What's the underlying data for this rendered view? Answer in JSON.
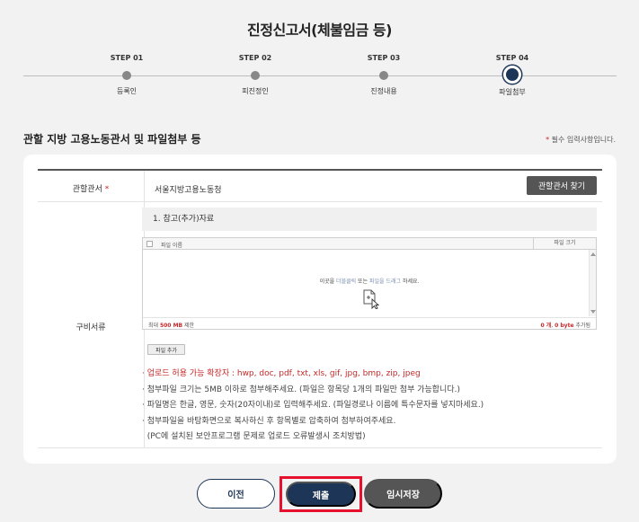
{
  "title": "진정신고서(체불임금 등)",
  "steps": [
    {
      "label": "STEP 01",
      "name": "등록인"
    },
    {
      "label": "STEP 02",
      "name": "피진정인"
    },
    {
      "label": "STEP 03",
      "name": "진정내용"
    },
    {
      "label": "STEP 04",
      "name": "파일첨부",
      "active": true
    }
  ],
  "section_title": "관할 지방 고용노동관서 및 파일첨부 등",
  "required_note": "필수 입력사항입니다.",
  "required_star": "*",
  "office": {
    "label": "관할관서",
    "value": "서울지방고용노동청",
    "find_button": "관할관서 찾기"
  },
  "documents": {
    "label": "구비서류",
    "ref_title": "1. 참고(추가)자료",
    "table": {
      "col_name": "파일 이름",
      "col_size": "파일 크기"
    },
    "drop_text": {
      "part1": "이곳을 ",
      "hl1": "더블클릭",
      "part2": " 또는 ",
      "hl2": "파일을 드래그",
      "part3": " 하세요."
    },
    "limit": {
      "prefix": "최대 ",
      "value": "500 MB",
      "suffix": " 제한"
    },
    "count": {
      "files": "0 개",
      "sep": ", ",
      "bytes": "0 byte",
      "suffix": " 추가됨"
    },
    "add_button": "파일 추가"
  },
  "notes": [
    "· 업로드 허용 가능 확장자 : hwp, doc, pdf, txt, xls, gif, jpg, bmp, zip, jpeg",
    "· 첨부파일 크기는 5MB 이하로 첨부해주세요. (파일은 항목당 1개의 파일만 첨부 가능합니다.)",
    "· 파일명은 한글, 영문, 숫자(20자이내)로 입력해주세요. (파일경로나 이름에 특수문자를 넣지마세요.)",
    "· 첨부파일을 바탕화면으로 복사하신 후 항목별로 압축하여 첨부하여주세요.",
    "  (PC에 설치된 보안프로그램 문제로 업로드 오류발생시 조치방법)"
  ],
  "buttons": {
    "prev": "이전",
    "submit": "제출",
    "temp_save": "임시저장"
  },
  "colors": {
    "accent": "#1d3557",
    "highlight_border": "#e8112d",
    "required": "#c62828"
  }
}
